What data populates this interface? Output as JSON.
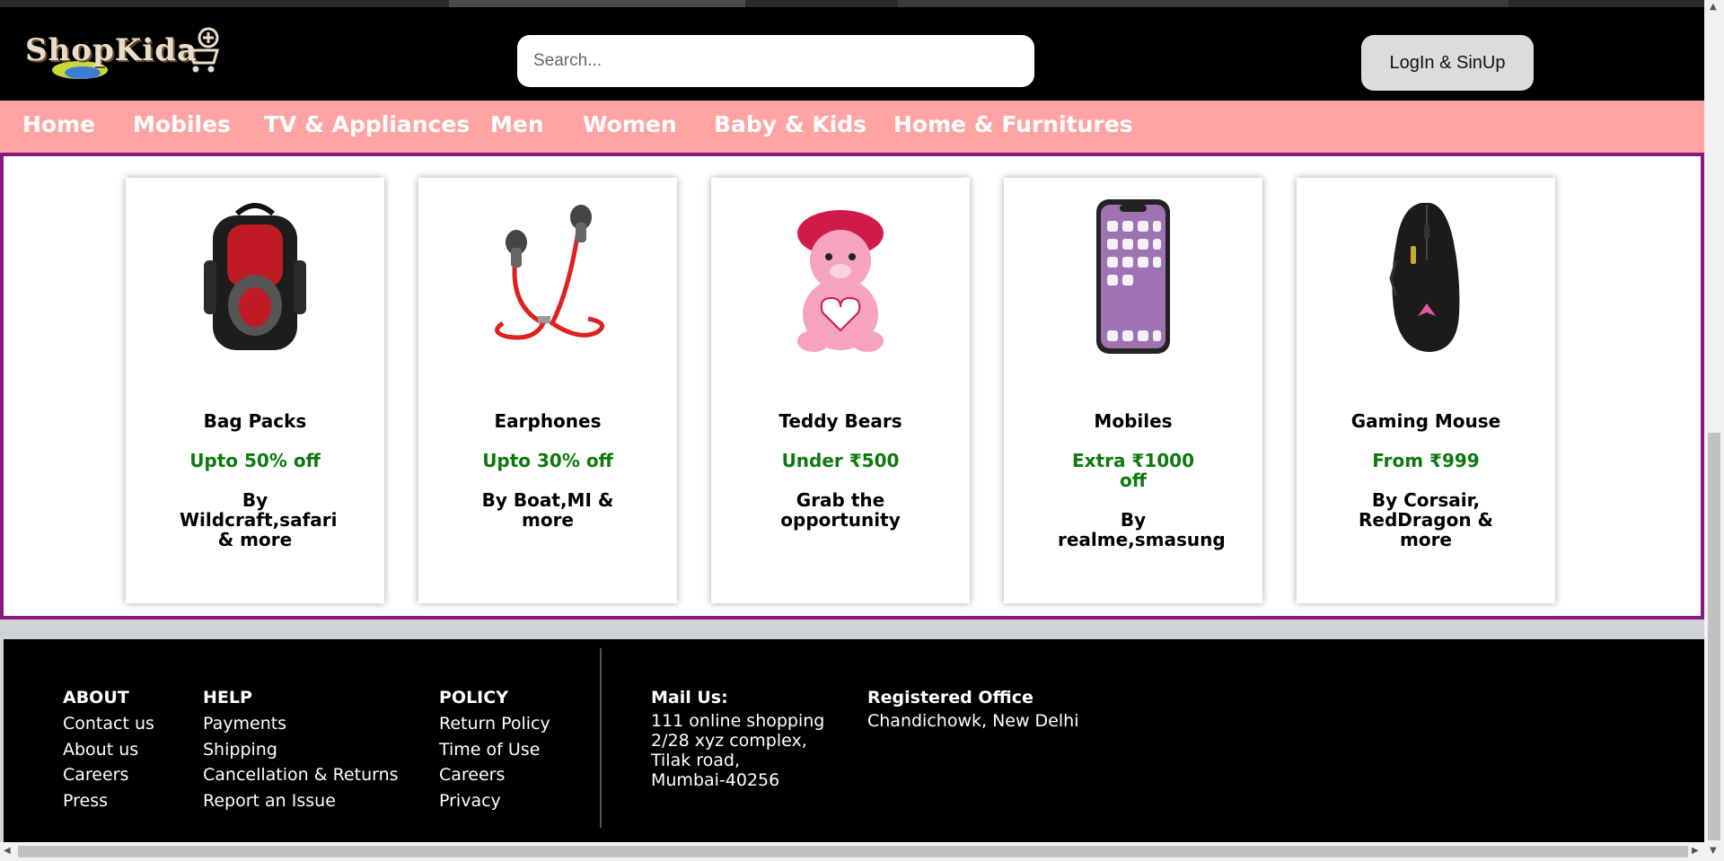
{
  "header": {
    "logo_text": "ShopKida",
    "search_placeholder": "Search...",
    "login_label": "LogIn & SinUp"
  },
  "nav": {
    "items": [
      {
        "label": "Home"
      },
      {
        "label": "Mobiles"
      },
      {
        "label": "TV & Appliances"
      },
      {
        "label": "Men"
      },
      {
        "label": "Women"
      },
      {
        "label": "Baby & Kids"
      },
      {
        "label": "Home & Furnitures"
      }
    ]
  },
  "cards": [
    {
      "name": "Bag Packs",
      "offer": "Upto 50% off",
      "by": "By Wildcraft,safari & more",
      "icon": "backpack-icon"
    },
    {
      "name": "Earphones",
      "offer": "Upto 30% off",
      "by": "By Boat,MI & more",
      "icon": "earphones-icon"
    },
    {
      "name": "Teddy Bears",
      "offer": "Under ₹500",
      "by": "Grab the opportunity",
      "icon": "teddy-bear-icon"
    },
    {
      "name": "Mobiles",
      "offer": "Extra ₹1000 off",
      "by": "By realme,smasung",
      "icon": "smartphone-icon"
    },
    {
      "name": "Gaming Mouse",
      "offer": "From ₹999",
      "by": "By Corsair, RedDragon & more",
      "icon": "gaming-mouse-icon"
    }
  ],
  "footer": {
    "about": {
      "heading": "ABOUT",
      "links": [
        "Contact us",
        "About us",
        "Careers",
        "Press"
      ]
    },
    "help": {
      "heading": "HELP",
      "links": [
        "Payments",
        "Shipping",
        "Cancellation & Returns",
        "Report an Issue"
      ]
    },
    "policy": {
      "heading": "POLICY",
      "links": [
        "Return Policy",
        "Time of Use",
        "Careers",
        "Privacy"
      ]
    },
    "mail": {
      "heading": "Mail Us:",
      "lines": [
        "111 online shopping",
        "2/28 xyz complex,",
        "Tilak road,",
        "Mumbai-40256"
      ]
    },
    "office": {
      "heading": "Registered Office",
      "lines": [
        "Chandichowk, New Delhi"
      ]
    }
  },
  "colors": {
    "nav_bg": "#ffa3a3",
    "content_border": "#8b1a7e",
    "offer_green": "#0c7a0c"
  }
}
